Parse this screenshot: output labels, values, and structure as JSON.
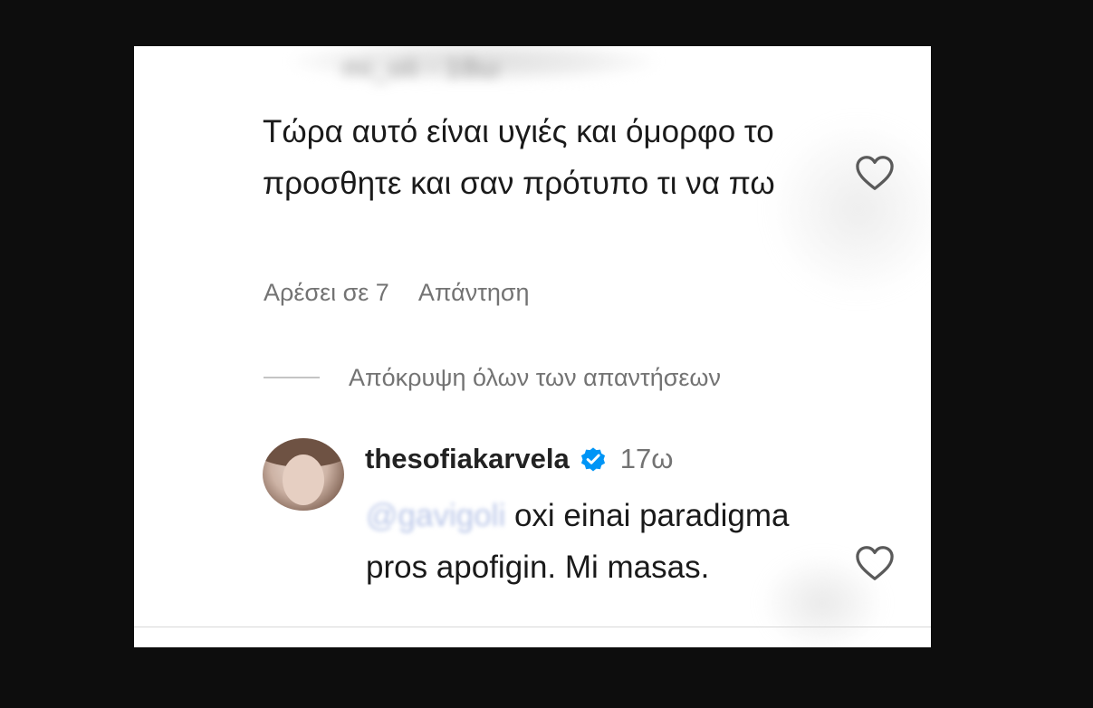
{
  "comment": {
    "blurred_username": "mi_oli · 18ω",
    "text": "Τώρα αυτό είναι υγιές και όμορφο το προσθητε και σαν πρότυπο τι να πω",
    "likes_label": "Αρέσει σε 7",
    "reply_label": "Απάντηση"
  },
  "hide_replies_label": "Απόκρυψη όλων των απαντήσεων",
  "reply": {
    "username": "thesofiakarvela",
    "verified": true,
    "time": "17ω",
    "mention": "@gavigoli",
    "text": " oxi einai paradigma pros apofigin. Mi masas."
  },
  "icons": {
    "like": "heart-outline-icon",
    "verified": "verified-badge-icon"
  },
  "colors": {
    "background": "#0d0d0d",
    "card": "#ffffff",
    "text": "#1a1a1a",
    "secondary_text": "#737373",
    "verified_blue": "#0095f6"
  }
}
